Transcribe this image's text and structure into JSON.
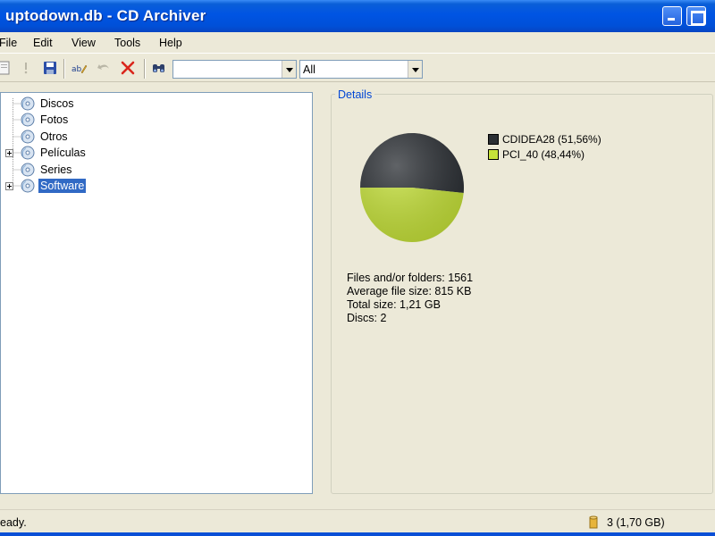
{
  "window": {
    "title": "uptodown.db - CD Archiver"
  },
  "menu": [
    "File",
    "Edit",
    "View",
    "Tools",
    "Help"
  ],
  "toolbar": {
    "search_value": "",
    "filter_value": "All",
    "icons": [
      "new-icon",
      "properties-icon",
      "save-icon",
      "rename-icon",
      "undo-icon",
      "delete-icon",
      "find-icon"
    ]
  },
  "tree": {
    "items": [
      {
        "label": "Discos",
        "expandable": false,
        "selected": false
      },
      {
        "label": "Fotos",
        "expandable": false,
        "selected": false
      },
      {
        "label": "Otros",
        "expandable": false,
        "selected": false
      },
      {
        "label": "Películas",
        "expandable": true,
        "selected": false
      },
      {
        "label": "Series",
        "expandable": false,
        "selected": false
      },
      {
        "label": "Software",
        "expandable": true,
        "selected": true
      }
    ]
  },
  "details": {
    "title": "Details",
    "stats": [
      "Files and/or folders: 1561",
      "Average file size: 815 KB",
      "Total size: 1,21 GB",
      "Discs: 2"
    ]
  },
  "chart_data": {
    "type": "pie",
    "categories": [
      "CDIDEA28",
      "PCI_40"
    ],
    "values": [
      51.56,
      48.44
    ],
    "legend": [
      "CDIDEA28 (51,56%)",
      "PCI_40 (48,44%)"
    ],
    "colors": [
      "#2b2f34",
      "#c6e23a"
    ],
    "legend_position": "top-right"
  },
  "status": {
    "text": "Ready.",
    "disc_count": "3 (1,70 GB)"
  }
}
